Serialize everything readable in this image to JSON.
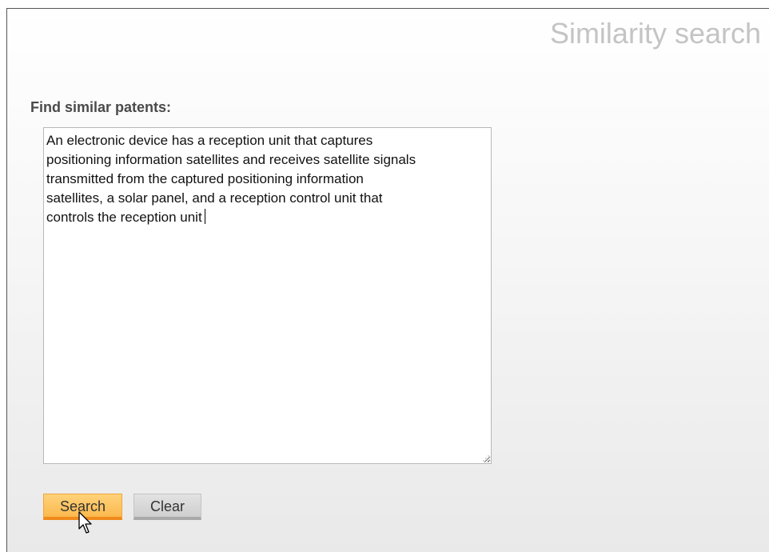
{
  "header": {
    "title": "Similarity search"
  },
  "form": {
    "heading": "Find similar patents:",
    "query_text": "An electronic device has a reception unit that captures\npositioning information satellites and receives satellite signals\ntransmitted from the captured positioning information\nsatellites, a solar panel, and a reception control unit that\ncontrols the reception unit",
    "search_label": "Search",
    "clear_label": "Clear"
  },
  "colors": {
    "search_button": "#fbb94e",
    "clear_button": "#cfcfcf",
    "title_text": "#c4c4c4"
  },
  "icons": {
    "resize_grip": "resize-grip-icon",
    "pointer": "mouse-pointer-icon"
  }
}
